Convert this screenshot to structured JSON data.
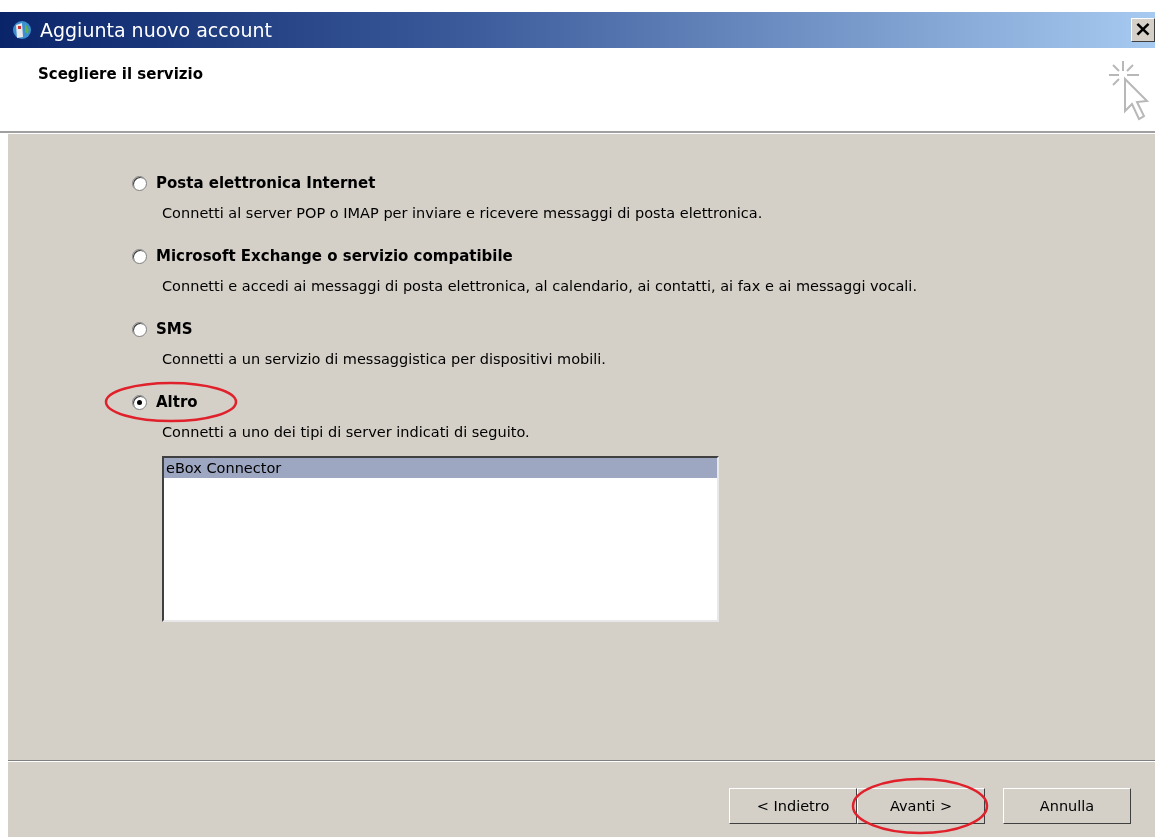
{
  "window": {
    "title": "Aggiunta nuovo account",
    "close": "×"
  },
  "header": {
    "title": "Scegliere il servizio"
  },
  "options": [
    {
      "label": "Posta elettronica Internet",
      "description": "Connetti al server POP o IMAP per inviare e ricevere messaggi di posta elettronica.",
      "selected": false,
      "circled": false
    },
    {
      "label": "Microsoft Exchange o servizio compatibile",
      "description": "Connetti e accedi ai messaggi di posta elettronica, al calendario, ai contatti, ai fax e ai messaggi vocali.",
      "selected": false,
      "circled": false
    },
    {
      "label": "SMS",
      "description": "Connetti a un servizio di messaggistica per dispositivi mobili.",
      "selected": false,
      "circled": false
    },
    {
      "label": "Altro",
      "description": "Connetti a uno dei tipi di server indicati di seguito.",
      "selected": true,
      "circled": true
    }
  ],
  "server_list": [
    {
      "label": "eBox Connector",
      "selected": true
    }
  ],
  "buttons": [
    {
      "label": "< Indietro",
      "circled": false
    },
    {
      "label": "Avanti >",
      "circled": true
    },
    {
      "label": "Annulla",
      "circled": false
    }
  ]
}
